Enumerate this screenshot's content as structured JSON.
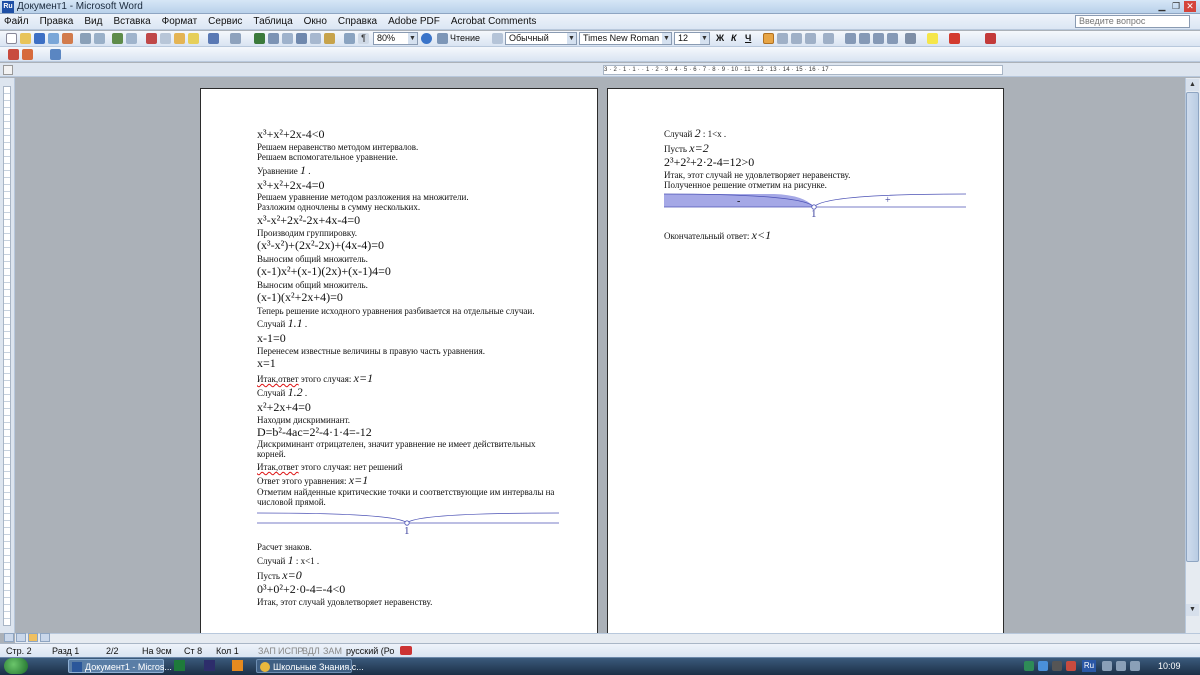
{
  "window": {
    "title": "Документ1 - Microsoft Word",
    "app_icon_text": "Ru"
  },
  "menu": [
    "Файл",
    "Правка",
    "Вид",
    "Вставка",
    "Формат",
    "Сервис",
    "Таблица",
    "Окно",
    "Справка",
    "Adobe PDF",
    "Acrobat Comments"
  ],
  "help_search_placeholder": "Введите вопрос",
  "toolbar": {
    "zoom": "80%",
    "read_mode": "Чтение",
    "style": "Обычный",
    "font": "Times New Roman",
    "font_size": "12",
    "bold": "Ж",
    "italic": "К",
    "underline": "Ч"
  },
  "ruler_text": "3 · 2 · 1 · 1 · · 1 · 2 · 3 · 4 · 5 · 6 · 7 · 8 · 9 · 10 · 11 · 12 · 13 · 14 · 15 · 16 · 17 ·",
  "page1": {
    "l1": "x³+x²+2x-4<0",
    "l2": "Решаем неравенство методом интервалов.",
    "l3": "Решаем вспомогательное уравнение.",
    "l4a": "Уравнение ",
    "l4b": "1",
    "l4c": " .",
    "l5": "x³+x²+2x-4=0",
    "l6": "Решаем уравнение методом разложения на множители.",
    "l7": "Разложим одночлены в сумму нескольких.",
    "l8": "x³-x²+2x²-2x+4x-4=0",
    "l9": "Производим группировку.",
    "l10": "(x³-x²)+(2x²-2x)+(4x-4)=0",
    "l11": "Выносим общий множитель.",
    "l12": "(x-1)x²+(x-1)(2x)+(x-1)4=0",
    "l13": "Выносим общий множитель.",
    "l14": "(x-1)(x²+2x+4)=0",
    "l15": "Теперь решение исходного уравнения разбивается на отдельные случаи.",
    "l16a": "Случай ",
    "l16b": "1.1",
    "l16c": " .",
    "l17": "x-1=0",
    "l18": "Перенесем известные величины в правую часть уравнения.",
    "l19": "x=1",
    "l20a": "Итак,ответ",
    "l20b": " этого случая: ",
    "l20c": "x=1",
    "l21a": "Случай ",
    "l21b": "1.2",
    "l21c": " .",
    "l22": "x²+2x+4=0",
    "l23": "Находим дискриминант.",
    "l24": "D=b²-4ac=2²-4·1·4=-12",
    "l25": "Дискриминант отрицателен, значит уравнение не имеет действительных",
    "l26": "корней.",
    "l27a": "Итак,ответ",
    "l27b": " этого случая: нет решений",
    "l28a": "Ответ этого уравнения: ",
    "l28b": "x=1",
    "l29": "Отметим найденные критические точки и соответствующие им интервалы на",
    "l30": "числовой прямой.",
    "axis_label": "1",
    "l31": "Расчет знаков.",
    "l32a": "Случай ",
    "l32b": "1",
    "l32c": "  : x<1 .",
    "l33a": "Пусть ",
    "l33b": "x=0",
    "l34": "0³+0²+2·0-4=-4<0",
    "l35": "Итак, этот случай удовлетворяет неравенству."
  },
  "page2": {
    "l1a": "Случай ",
    "l1b": "2",
    "l1c": "  : 1<x .",
    "l2a": "Пусть ",
    "l2b": "x=2",
    "l3": "2³+2²+2·2-4=12>0",
    "l4": "Итак, этот случай не удовлетворяет неравенству.",
    "l5": "Полученное решение отметим на рисунке.",
    "minus": "-",
    "plus": "+",
    "axis_label": "1",
    "l6a": "Окончательный ответ: ",
    "l6b": "x<1"
  },
  "status": {
    "page": "Стр. 2",
    "section": "Разд 1",
    "pages": "2/2",
    "at": "На 9см",
    "line": "Ст 8",
    "col": "Кол 1",
    "rec": "ЗАП",
    "trk": "ИСПР",
    "ext": "ВДЛ",
    "ovr": "ЗАМ",
    "lang": "русский (Ро"
  },
  "taskbar": {
    "word": "Документ1 - Micros...",
    "browser": "Школьные Знания.с...",
    "lang": "Ru",
    "clock": "10:09"
  },
  "colors": {
    "accent": "#1e4fa5",
    "shade": "#a5a8e6",
    "curve": "#4c52b5"
  }
}
